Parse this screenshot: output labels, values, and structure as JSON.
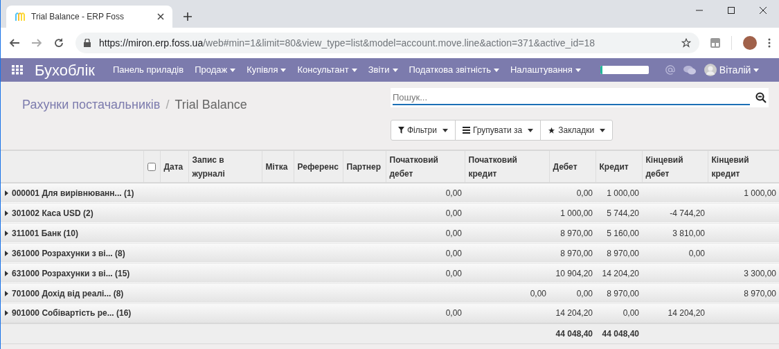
{
  "browser": {
    "tab_title": "Trial Balance - ERP Foss",
    "url_host": "https://miron.erp.foss.ua",
    "url_rest": "/web#min=1&limit=80&view_type=list&model=account.move.line&action=371&active_id=18"
  },
  "navbar": {
    "app_name": "Бухоблік",
    "menus": [
      {
        "label": "Панель приладів",
        "dropdown": false
      },
      {
        "label": "Продаж",
        "dropdown": true
      },
      {
        "label": "Купівля",
        "dropdown": true
      },
      {
        "label": "Консультант",
        "dropdown": true
      },
      {
        "label": "Звіти",
        "dropdown": true
      },
      {
        "label": "Податкова звітність",
        "dropdown": true
      },
      {
        "label": "Налаштування",
        "dropdown": true
      }
    ],
    "progress": {
      "level": 0.05
    },
    "user": "Віталій"
  },
  "breadcrumb": [
    "Рахунки постачальників",
    "Trial Balance"
  ],
  "breadcrumb_separator": "/",
  "search": {
    "placeholder": "Пошук..."
  },
  "filter_buttons": [
    {
      "kind": "filter",
      "label": "Фільтри"
    },
    {
      "kind": "group",
      "label": "Групувати за"
    },
    {
      "kind": "favorite",
      "label": "Закладки"
    }
  ],
  "table": {
    "select_all": {
      "checked": false
    },
    "columns": [
      "Дата",
      "Запис в журналі",
      "Мітка",
      "Референс",
      "Партнер",
      "Початковий дебет",
      "Початковий кредит",
      "Дебет",
      "Кредит",
      "Кінцевий дебет",
      "Кінцевий кредит"
    ],
    "groups": [
      {
        "label": "000001 Для вирівнюванн... (1)",
        "expanded": false,
        "values": {
          "opening_debit": "0,00",
          "debit": "0,00",
          "credit": "1 000,00",
          "closing_credit": "1 000,00"
        }
      },
      {
        "label": "301002 Каса USD (2)",
        "expanded": false,
        "values": {
          "opening_debit": "0,00",
          "debit": "1 000,00",
          "credit": "5 744,20",
          "closing_debit": "-4 744,20"
        }
      },
      {
        "label": "311001 Банк (10)",
        "expanded": false,
        "values": {
          "opening_debit": "0,00",
          "debit": "8 970,00",
          "credit": "5 160,00",
          "closing_debit": "3 810,00"
        }
      },
      {
        "label": "361000 Розрахунки з ві... (8)",
        "expanded": false,
        "values": {
          "opening_debit": "0,00",
          "debit": "8 970,00",
          "credit": "8 970,00",
          "closing_debit": "0,00"
        }
      },
      {
        "label": "631000 Розрахунки з ві... (15)",
        "expanded": false,
        "values": {
          "opening_debit": "0,00",
          "debit": "10 904,20",
          "credit": "14 204,20",
          "closing_credit": "3 300,00"
        }
      },
      {
        "label": "701000 Дохід від реалі... (8)",
        "expanded": false,
        "values": {
          "opening_credit": "0,00",
          "debit": "0,00",
          "credit": "8 970,00",
          "closing_credit": "8 970,00"
        }
      },
      {
        "label": "901000 Собівартість ре... (16)",
        "expanded": false,
        "values": {
          "opening_debit": "0,00",
          "debit": "14 204,20",
          "credit": "0,00",
          "closing_debit": "14 204,20"
        }
      }
    ],
    "totals": {
      "debit": "44 048,40",
      "credit": "44 048,40"
    }
  }
}
